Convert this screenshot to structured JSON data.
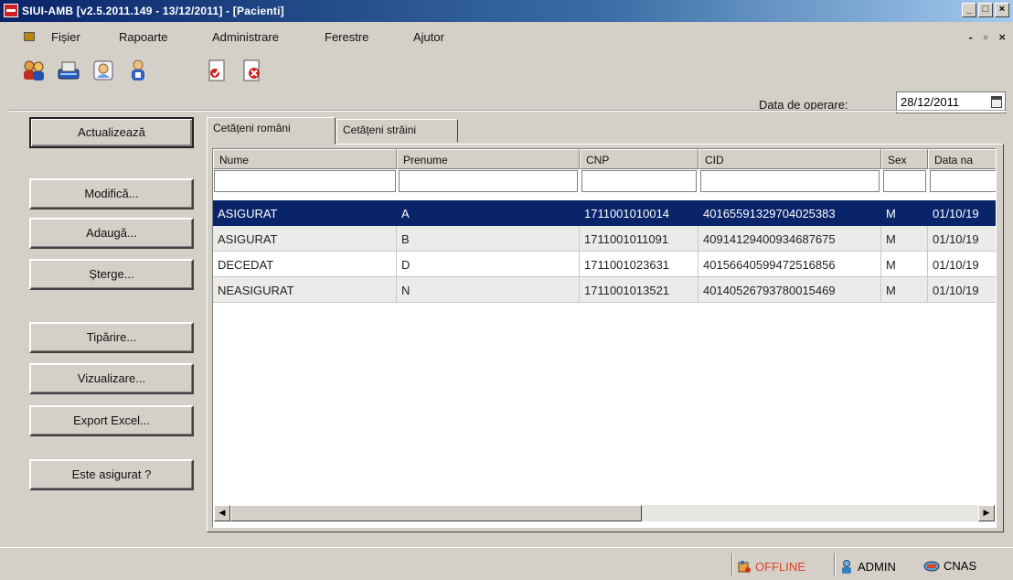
{
  "window": {
    "title": "SIUI-AMB [v2.5.2011.149 - 13/12/2011] - [Pacienti]",
    "controls": [
      "_",
      "□",
      "×"
    ]
  },
  "menu": {
    "items": [
      {
        "label": "Fișier"
      },
      {
        "label": "Rapoarte"
      },
      {
        "label": "Administrare"
      },
      {
        "label": "Ferestre"
      },
      {
        "label": "Ajutor"
      }
    ],
    "mdi_controls": [
      "-",
      "▫",
      "×"
    ]
  },
  "toolbar": {
    "icons": [
      "users-icon",
      "card-reader-icon",
      "doctor-icon",
      "patient-icon",
      "report-icon",
      "delete-report-icon"
    ],
    "date_label": "Data de operare:",
    "date_value": "28/12/2011"
  },
  "actions": {
    "refresh": "Actualizează",
    "modify": "Modifică...",
    "add": "Adaugă...",
    "delete": "Șterge...",
    "print": "Tipărire...",
    "preview": "Vizualizare...",
    "export": "Export Excel...",
    "check_insured": "Este asigurat ?"
  },
  "tabs": [
    {
      "label": "Cetățeni români",
      "active": true
    },
    {
      "label": "Cetățeni străini",
      "active": false
    }
  ],
  "table": {
    "columns": [
      "Nume",
      "Prenume",
      "CNP",
      "CID",
      "Sex",
      "Data na"
    ],
    "rows": [
      [
        "ASIGURAT",
        "A",
        "1711001010014",
        "40165591329704025383",
        "M",
        "01/10/19"
      ],
      [
        "ASIGURAT",
        "B",
        "1711001011091",
        "40914129400934687675",
        "M",
        "01/10/19"
      ],
      [
        "DECEDAT",
        "D",
        "1711001023631",
        "40156640599472516856",
        "M",
        "01/10/19"
      ],
      [
        "NEASIGURAT",
        "N",
        "1711001013521",
        "40140526793780015469",
        "M",
        "01/10/19"
      ]
    ],
    "selected_row": 0
  },
  "status": {
    "connection": "OFFLINE",
    "user": "ADMIN",
    "server": "CNAS"
  },
  "colors": {
    "title_gradient_start": "#0a246a",
    "selection": "#0a246a",
    "offline": "#e04020"
  }
}
